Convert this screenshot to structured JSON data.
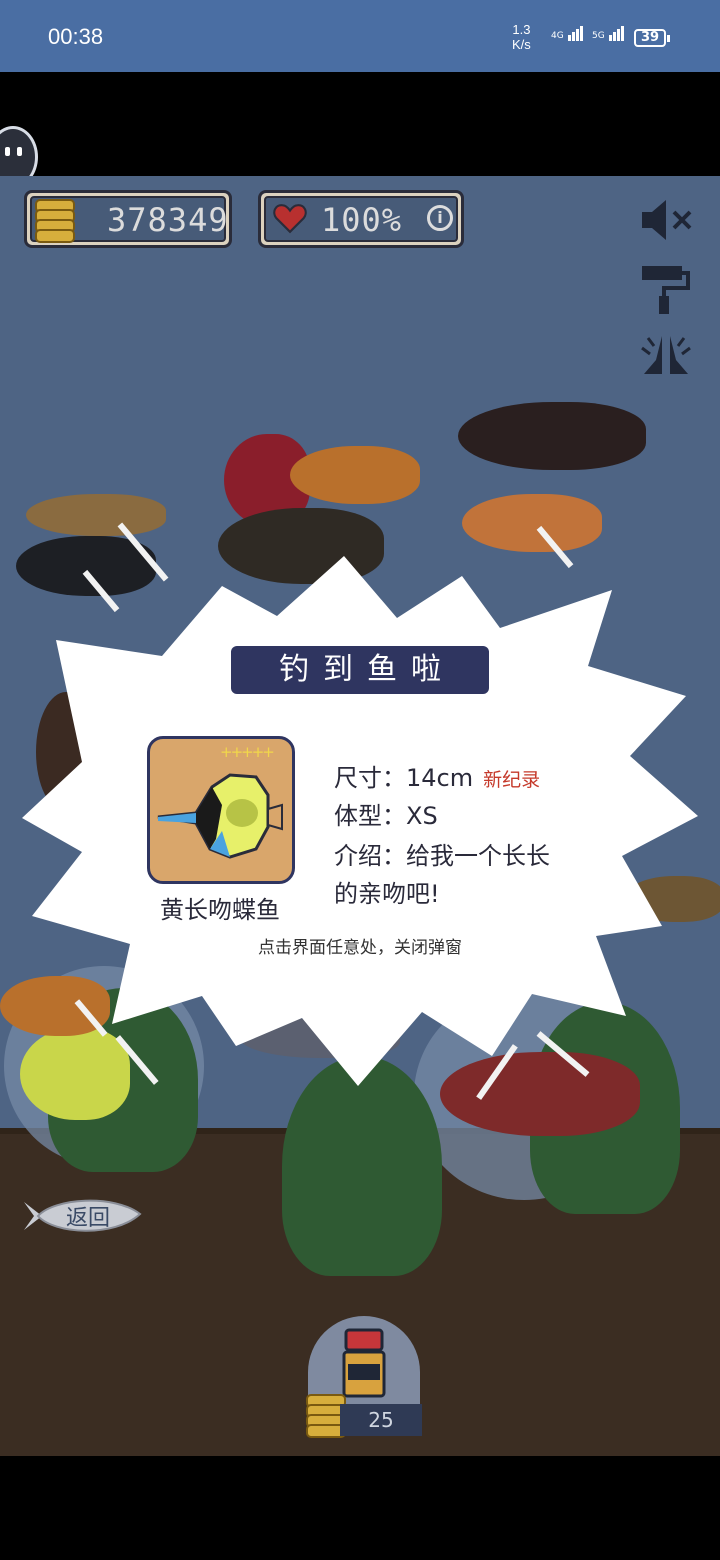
{
  "status_bar": {
    "time": "00:38",
    "net_speed_value": "1.3",
    "net_speed_unit": "K/s",
    "signal_1": "4G",
    "signal_2": "5G",
    "battery": "39"
  },
  "hud": {
    "coins": "378349",
    "health": "100%",
    "info_label": "i"
  },
  "side_icons": [
    "sound-muted-icon",
    "paint-roller-icon",
    "pray-hands-icon"
  ],
  "popup": {
    "title": "钓到鱼啦",
    "fish_name": "黄长吻蝶鱼",
    "stars": "+++++",
    "size_label": "尺寸：",
    "size_value": "14cm",
    "record_badge": "新纪录",
    "type_label": "体型：",
    "type_value": "XS",
    "intro_label": "介绍：",
    "intro_line1": "给我一个长长",
    "intro_line2": "的亲吻吧!",
    "close_hint": "点击界面任意处，关闭弹窗"
  },
  "back_button": {
    "label": "返回"
  },
  "gacha": {
    "cost": "25"
  },
  "colors": {
    "status_bar": "#4a6ea3",
    "water": "#4e6484",
    "floor": "#3b2d22",
    "title_bg": "#2f3560",
    "record_red": "#c53a2b",
    "coin_gold": "#d7ae3c"
  }
}
